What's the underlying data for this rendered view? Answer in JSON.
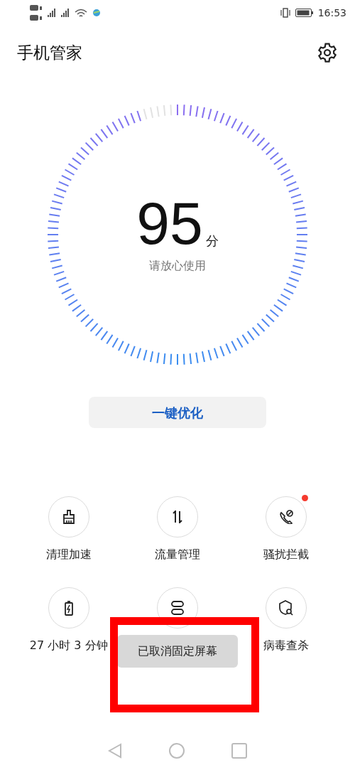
{
  "status_bar": {
    "time": "16:53"
  },
  "header": {
    "title": "手机管家"
  },
  "score": {
    "value": "95",
    "unit": "分",
    "caption": "请放心使用",
    "level": 0.95
  },
  "optimize_button": {
    "label": "一键优化"
  },
  "features": [
    {
      "label": "清理加速",
      "badge": false
    },
    {
      "label": "流量管理",
      "badge": false
    },
    {
      "label": "骚扰拦截",
      "badge": true
    },
    {
      "label": "27 小时 3 分钟",
      "badge": false
    },
    {
      "badge": false
    },
    {
      "label": "病毒查杀",
      "badge": false
    }
  ],
  "toast": {
    "text": "已取消固定屏幕"
  }
}
